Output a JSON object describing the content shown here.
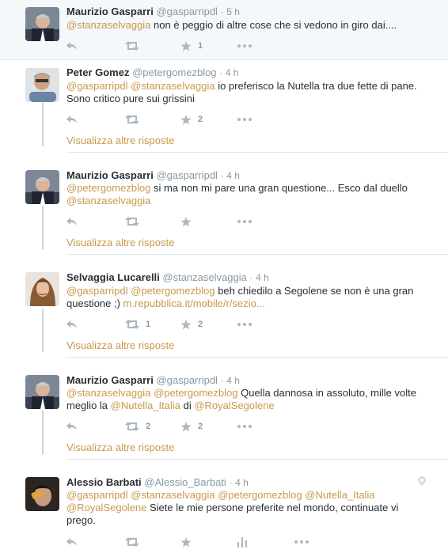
{
  "colors": {
    "mention": "#c79a4b",
    "muted": "#8899a6",
    "icon": "#aab8c2"
  },
  "tweets": [
    {
      "name": "Maurizio Gasparri",
      "handle": "@gasparripdl",
      "sep": "·",
      "time": "5 h",
      "text_parts": [
        "@stanzaselvaggia",
        " non è peggio di altre cose che si vedono in giro dai...."
      ],
      "retweets": "",
      "favorites": "1"
    },
    {
      "name": "Peter Gomez",
      "handle": "@petergomezblog",
      "sep": "·",
      "time": "4 h",
      "text_parts": [
        "@gasparripdl",
        "@stanzaselvaggia",
        " io preferisco la Nutella tra due fette di pane.",
        "Sono critico pure sui grissini"
      ],
      "retweets": "",
      "favorites": "2",
      "more_replies": "Visualizza altre risposte"
    },
    {
      "name": "Maurizio Gasparri",
      "handle": "@gasparripdl",
      "sep": "·",
      "time": "4 h",
      "text_parts": [
        "@petergomezblog",
        " si ma non mi pare una gran questione... Esco dal duello",
        "@stanzaselvaggia"
      ],
      "retweets": "",
      "favorites": "",
      "more_replies": "Visualizza altre risposte"
    },
    {
      "name": "Selvaggia Lucarelli",
      "handle": "@stanzaselvaggia",
      "sep": "·",
      "time": "4 h",
      "text_parts": [
        "@gasparripdl",
        "@petergomezblog",
        " beh chiedilo a Segolene se non è una gran",
        "questione ;) ",
        "m.repubblica.it/mobile/r/sezio..."
      ],
      "retweets": "1",
      "favorites": "2",
      "more_replies": "Visualizza altre risposte"
    },
    {
      "name": "Maurizio Gasparri",
      "handle": "@gasparripdl",
      "sep": "·",
      "time": "4 h",
      "text_parts": [
        "@stanzaselvaggia",
        "@petergomezblog",
        " Quella dannosa in assoluto, mille volte",
        "meglio la ",
        "@Nutella_Italia",
        " di ",
        "@RoyalSegolene"
      ],
      "retweets": "2",
      "favorites": "2",
      "more_replies": "Visualizza altre risposte"
    },
    {
      "name": "Alessio Barbati",
      "handle": "@Alessio_Barbati",
      "sep": "·",
      "time": "4 h",
      "text_parts": [
        "@gasparripdl",
        "@stanzaselvaggia",
        "@petergomezblog",
        "@Nutella_Italia",
        "@RoyalSegolene",
        " Siete le mie persone preferite nel mondo, continuate vi",
        "prego."
      ],
      "retweets": "",
      "favorites": ""
    }
  ]
}
